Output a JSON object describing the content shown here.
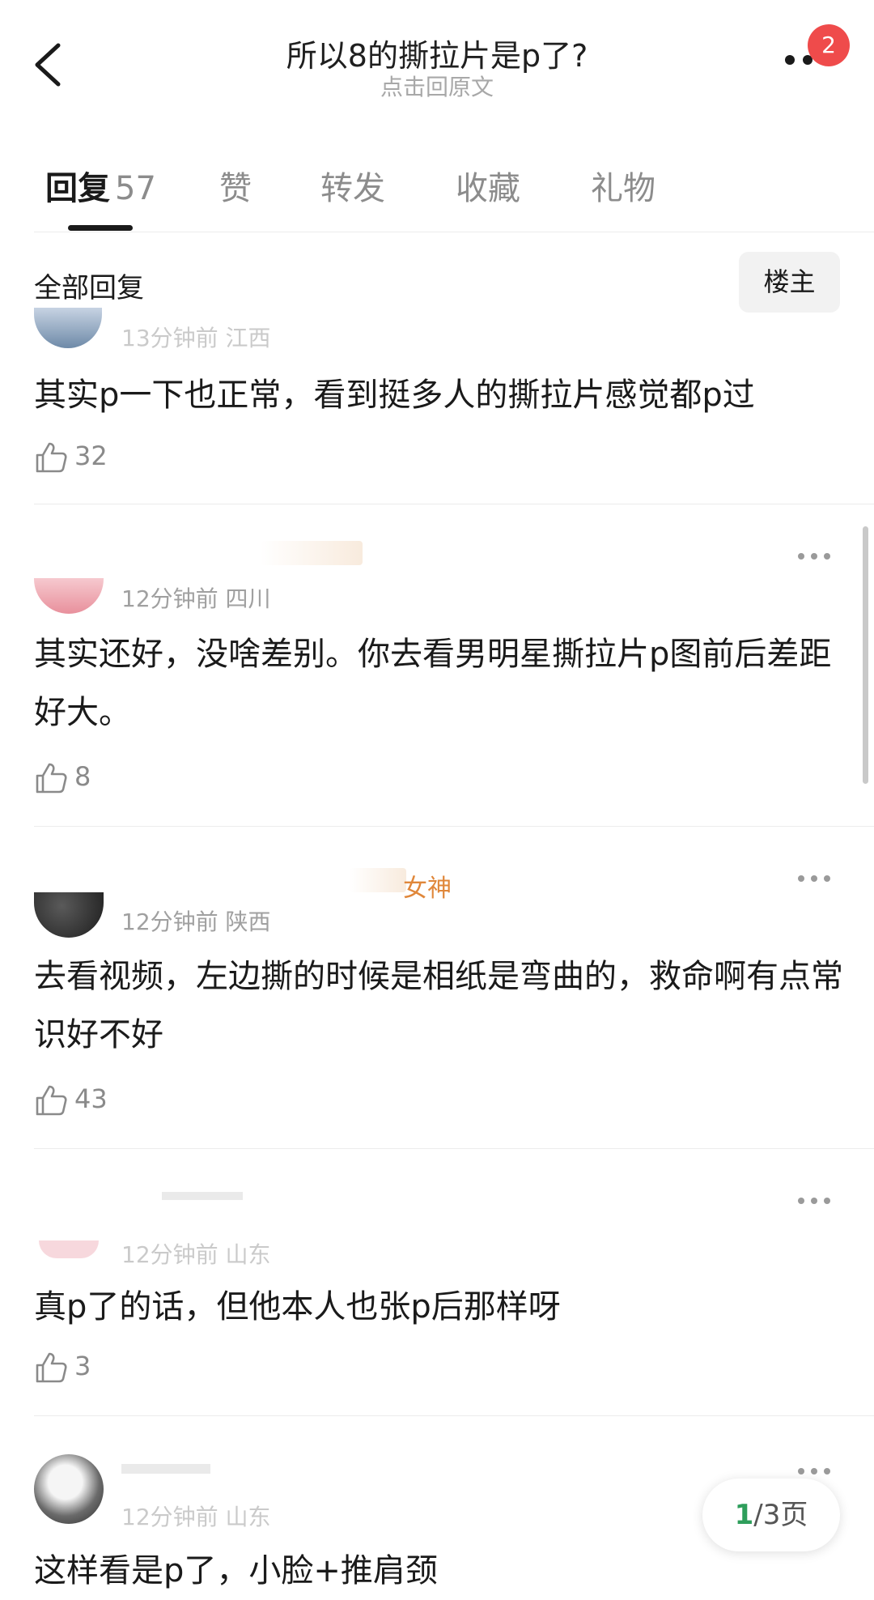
{
  "header": {
    "title": "所以8的撕拉片是p了?",
    "subtitle": "点击回原文",
    "notification_count": "2"
  },
  "tabs": [
    {
      "label": "回复",
      "count": "57",
      "active": true
    },
    {
      "label": "赞"
    },
    {
      "label": "转发"
    },
    {
      "label": "收藏"
    },
    {
      "label": "礼物"
    }
  ],
  "filter": {
    "section_title": "全部回复",
    "owner_button": "楼主"
  },
  "comments": [
    {
      "meta": "13分钟前 江西",
      "text": "其实p一下也正常，看到挺多人的撕拉片感觉都p过",
      "likes": "32"
    },
    {
      "meta": "12分钟前 四川",
      "text": "其实还好，没啥差别。你去看男明星撕拉片p图前后差距好大。",
      "likes": "8"
    },
    {
      "badge": "女神",
      "meta": "12分钟前 陕西",
      "text": "去看视频，左边撕的时候是相纸是弯曲的，救命啊有点常识好不好",
      "likes": "43"
    },
    {
      "meta": "12分钟前 山东",
      "text": "真p了的话，但他本人也张p后那样呀",
      "likes": "3"
    },
    {
      "meta": "12分钟前 山东",
      "text": "这样看是p了，小脸+推肩颈"
    }
  ],
  "pagination": {
    "current": "1",
    "total": "/3页"
  },
  "colors": {
    "accent": "#2e9e5b",
    "badge": "#ef4b4b",
    "tag": "#e0873a"
  }
}
